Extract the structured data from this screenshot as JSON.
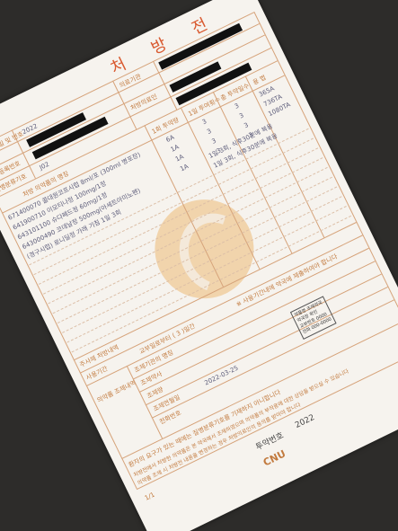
{
  "document": {
    "title": "처 방 전",
    "fields": {
      "name_label": "성 명",
      "ssn_label": "주민등록번호",
      "issue_date_label": "교부연월일 및 번호",
      "issue_date": "2022",
      "institution_label": "의료기관",
      "doctor_label": "처방의료인",
      "disease_code_label": "질병분류기호",
      "disease_code": "J02",
      "drug_header": "처방 의약품의 명칭",
      "dose_header": "1회 투약량",
      "freq_header": "1일 투여횟수",
      "days_header": "총 투약일수",
      "usage_header": "용 법",
      "injection_label": "주사제 처방내역",
      "usage_period_label": "사용기간",
      "usage_period_value": "교부일로부터 ( 3 )일간",
      "prep_label": "의약품 조제내역",
      "prep_institution": "조제기관의 명칭",
      "pharmacist": "조제약사",
      "prep_amount": "조제량",
      "prep_date_label": "조제연월일",
      "prep_date": "2022-03-25",
      "contact_label": "전화번호",
      "note": "※ 사용기간내에 약국에 제출하여야 합니다",
      "footer_notice": "환자의 요구가 있는 때에는 질병분류기호를 기재하지 아니합니다",
      "footer_lines": [
        "처방전에서 처방한 의약품은 본 약국에서 조제하였으며 의약품의 부작용에 대한 상담을 받으실 수 있습니다",
        "의약품 조제 시 처방전 내용을 변경하는 경우 처방의료인의 동의를 받아야 합니다"
      ],
      "page": "1/1",
      "receipt_label": "투약번호",
      "receipt_value": "2022",
      "logo_text": "CNU",
      "stamp_text": "약품명 조제약국\n약국장 확인\n교부번호 0000\n전화 000-0000"
    },
    "drugs": [
      {
        "name": "671400070 콜대원코프시럽 8ml/포 (300ml 병포장)",
        "dose": "6A",
        "freq": "3",
        "days": "3"
      },
      {
        "name": "641900710 이모티나정 100mg/1정",
        "dose": "1A",
        "freq": "3",
        "days": "3"
      },
      {
        "name": "643101100 슈다페드정 60mg/1정",
        "dose": "1A",
        "freq": "3",
        "days": "3"
      },
      {
        "name": "643000490 코데날정 500mg(아세트아미노펜)",
        "dose": "1A",
        "freq": "3",
        "days": "3"
      },
      {
        "name": "(경구시럽) 로니딜정 가래 기침 1일 3회",
        "dose": "",
        "freq": "",
        "days": ""
      }
    ],
    "usage_values": [
      "365A",
      "736TA",
      "1080TA"
    ],
    "usage_text": "1일 3회, 식후30분에 복용",
    "usage_text2": "1일 3회, 식후30분에 복용"
  }
}
